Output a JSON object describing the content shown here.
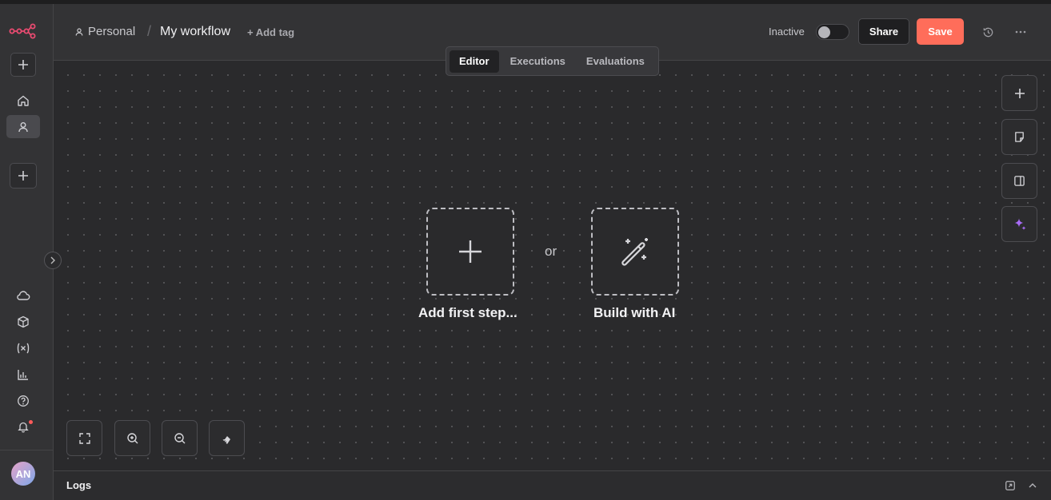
{
  "header": {
    "owner": "Personal",
    "workflow_name": "My workflow",
    "add_tag": "+ Add tag",
    "status_label": "Inactive",
    "share_label": "Share",
    "save_label": "Save"
  },
  "tabs": [
    {
      "label": "Editor",
      "active": true
    },
    {
      "label": "Executions",
      "active": false
    },
    {
      "label": "Evaluations",
      "active": false
    }
  ],
  "canvas": {
    "add_first_step": "Add first step...",
    "or": "or",
    "build_with_ai": "Build with AI"
  },
  "user": {
    "initials": "AN"
  },
  "logs": {
    "label": "Logs"
  },
  "colors": {
    "accent": "#ff6d5a",
    "ai": "#a86cf5"
  },
  "icons": {
    "sidebar": [
      "plus-icon",
      "home-icon",
      "user-icon",
      "plus-icon",
      "cloud-icon",
      "package-icon",
      "variables-icon",
      "insights-icon",
      "help-icon",
      "bell-icon"
    ],
    "canvas_right": [
      "plus-icon",
      "sticky-note-icon",
      "panel-icon",
      "sparkle-icon"
    ],
    "zoom": [
      "fit-view-icon",
      "zoom-in-icon",
      "zoom-out-icon",
      "tidy-up-icon"
    ]
  }
}
